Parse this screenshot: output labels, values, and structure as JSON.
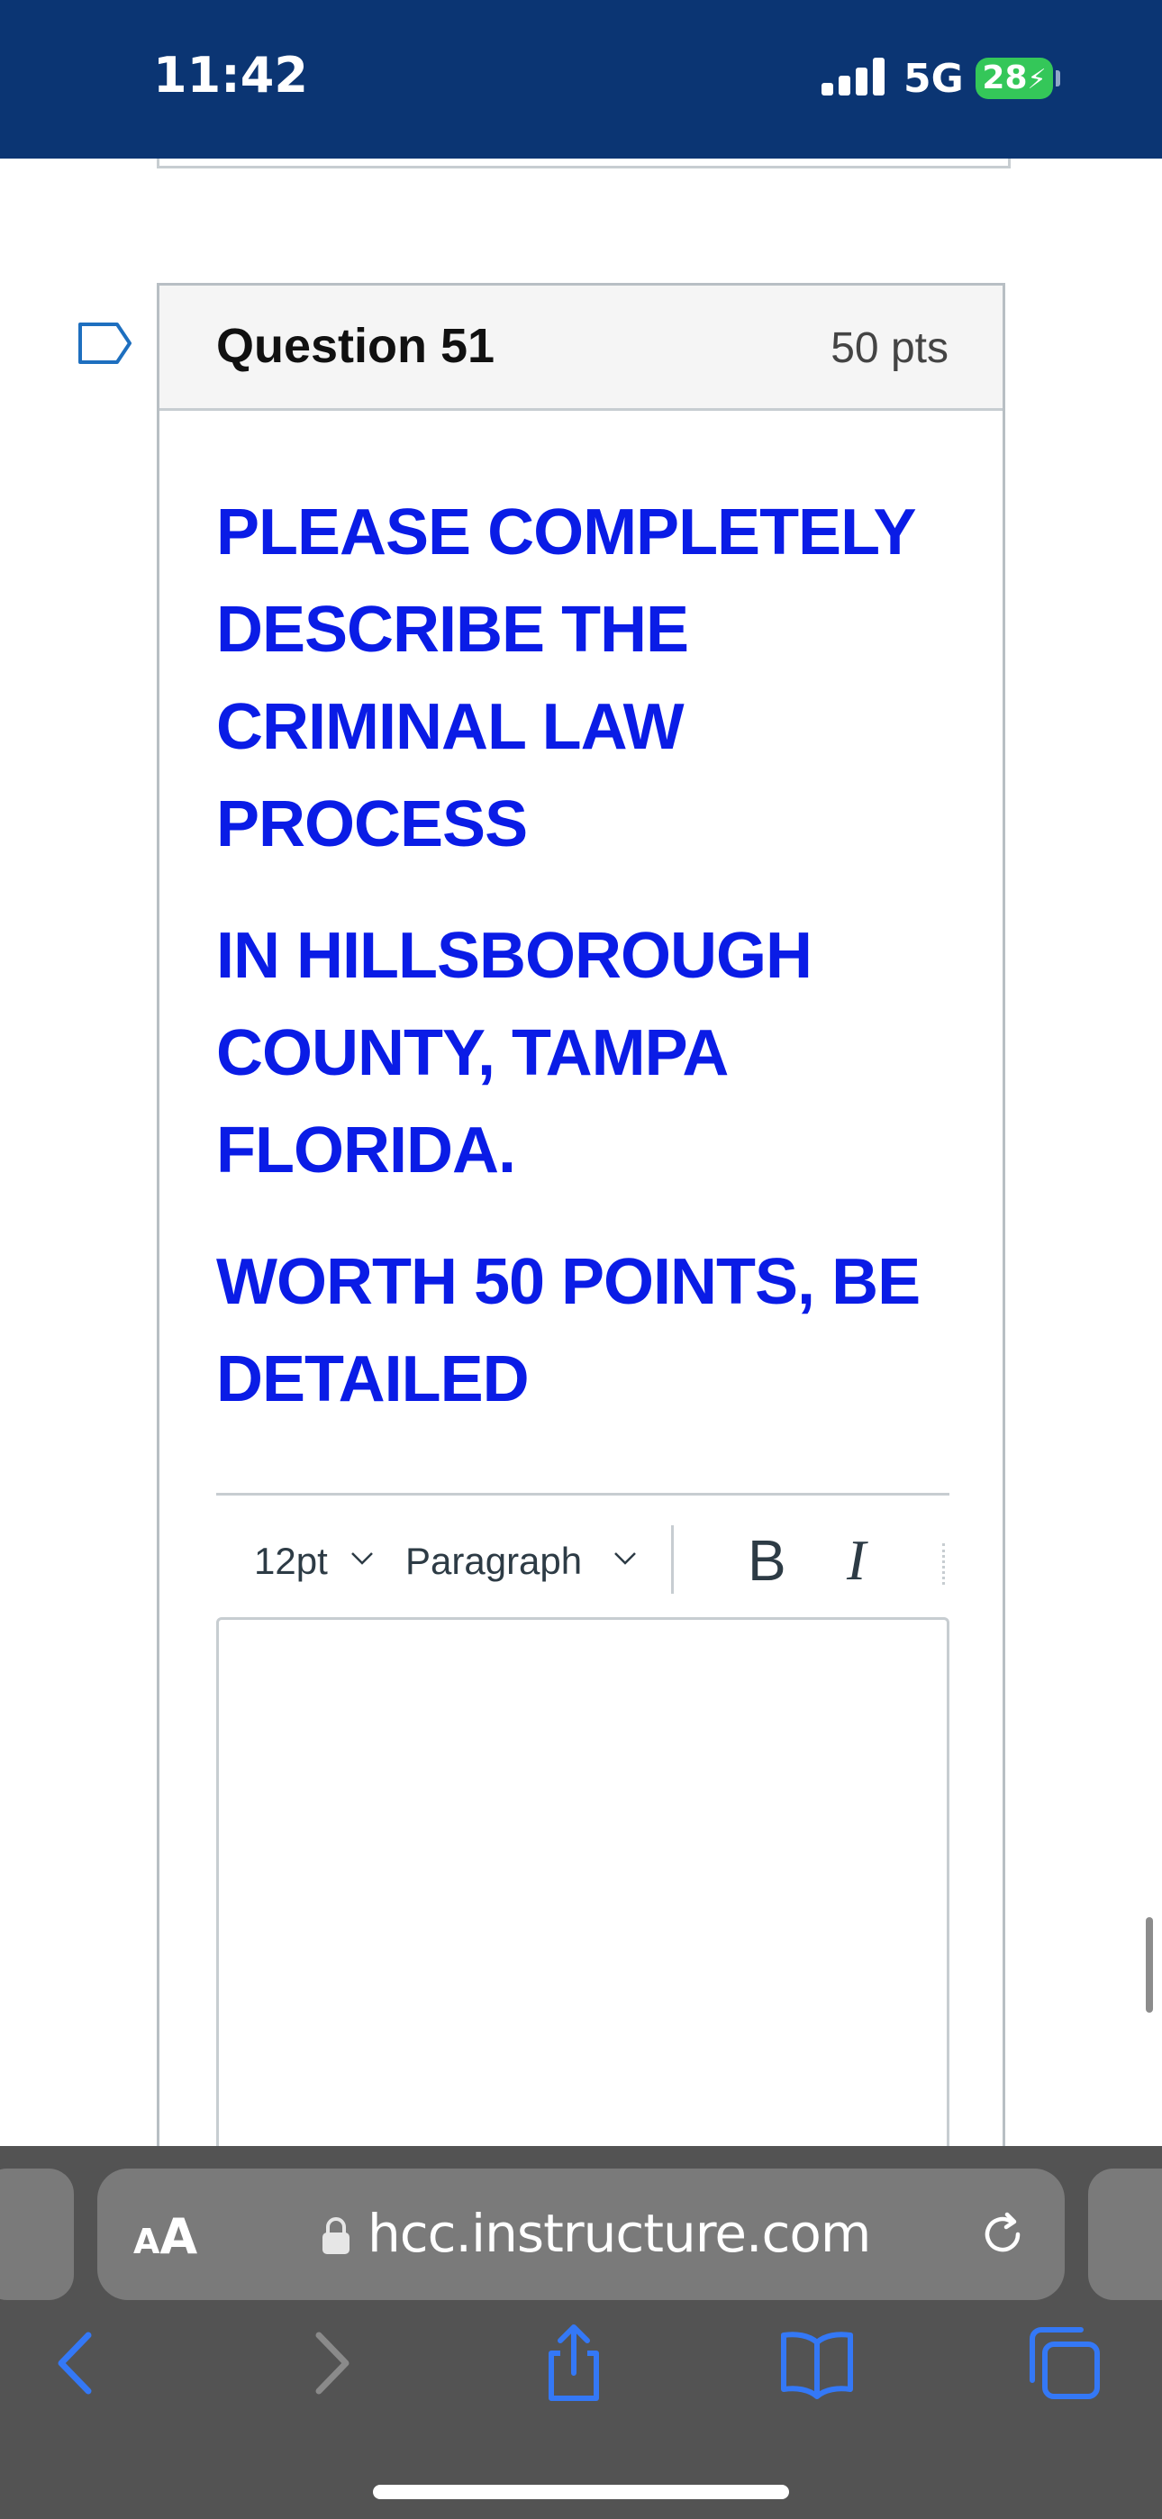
{
  "status_bar": {
    "time": "11:42",
    "network": "5G",
    "battery": "28"
  },
  "question": {
    "title": "Question 51",
    "points": "50 pts",
    "prompt": [
      "PLEASE COMPLETELY DESCRIBE THE CRIMINAL LAW PROCESS",
      "IN HILLSBOROUGH COUNTY, TAMPA FLORIDA.",
      "WORTH 50 POINTS, BE DETAILED"
    ]
  },
  "editor": {
    "font_size": "12pt",
    "block_format": "Paragraph",
    "bold_label": "B",
    "italic_label": "I",
    "value": ""
  },
  "browser": {
    "text_size_label_small": "A",
    "text_size_label_big": "A",
    "url": "hcc.instructure.com"
  },
  "colors": {
    "status_bar": "#0b3573",
    "prompt_text": "#0a1ce6",
    "battery": "#34c759",
    "safari_blue": "#3478f6"
  }
}
